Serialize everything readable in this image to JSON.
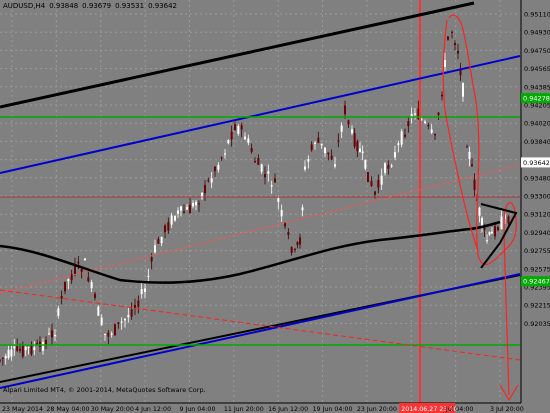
{
  "header": {
    "symbol": "AUDUSD,H4",
    "ohlc": [
      "0.93848",
      "0.93679",
      "0.93531",
      "0.93642"
    ]
  },
  "copyright": "Alpari Limited MT4, © 2001-2014, MetaQuotes Software Corp.",
  "price_axis": {
    "ticks": [
      "0.95110",
      "0.94930",
      "0.94750",
      "0.94565",
      "0.94385",
      "0.94205",
      "0.94020",
      "0.93840",
      "0.93660",
      "0.93480",
      "0.93300",
      "0.93120",
      "0.92940",
      "0.92755",
      "0.92575",
      "0.92395",
      "0.92215",
      "0.92035"
    ],
    "labels": [
      {
        "text": "0.94278",
        "color": "#00aa00",
        "price": 0.94278
      },
      {
        "text": "0.93642",
        "color": "#ffffff",
        "price": 0.93642
      },
      {
        "text": "0.92467",
        "color": "#00aa00",
        "price": 0.92467
      }
    ]
  },
  "time_axis": {
    "ticks": [
      "23 May 2014",
      "28 May 04:00",
      "30 May 20:00",
      "4 Jun 12:00",
      "9 Jun 04:00",
      "11 Jun 20:00",
      "16 Jun 12:00",
      "19 Jun 04:00",
      "23 Jun 20:00",
      "2014.06.27 23:00",
      "Jul 04:00",
      "3 Jul 20:00"
    ],
    "highlighted": "2014.06.27 23:00",
    "highlight_color": "#ff3333"
  },
  "colors": {
    "background": "#808080",
    "bull_candle": "#ffffff",
    "bear_candle": "#6b0000",
    "channel_black": "#000000",
    "channel_blue": "#0000cc",
    "support_green": "#00aa00",
    "ma": "#000000",
    "vline": "#ff3333",
    "drawing": "#ff2222"
  }
}
